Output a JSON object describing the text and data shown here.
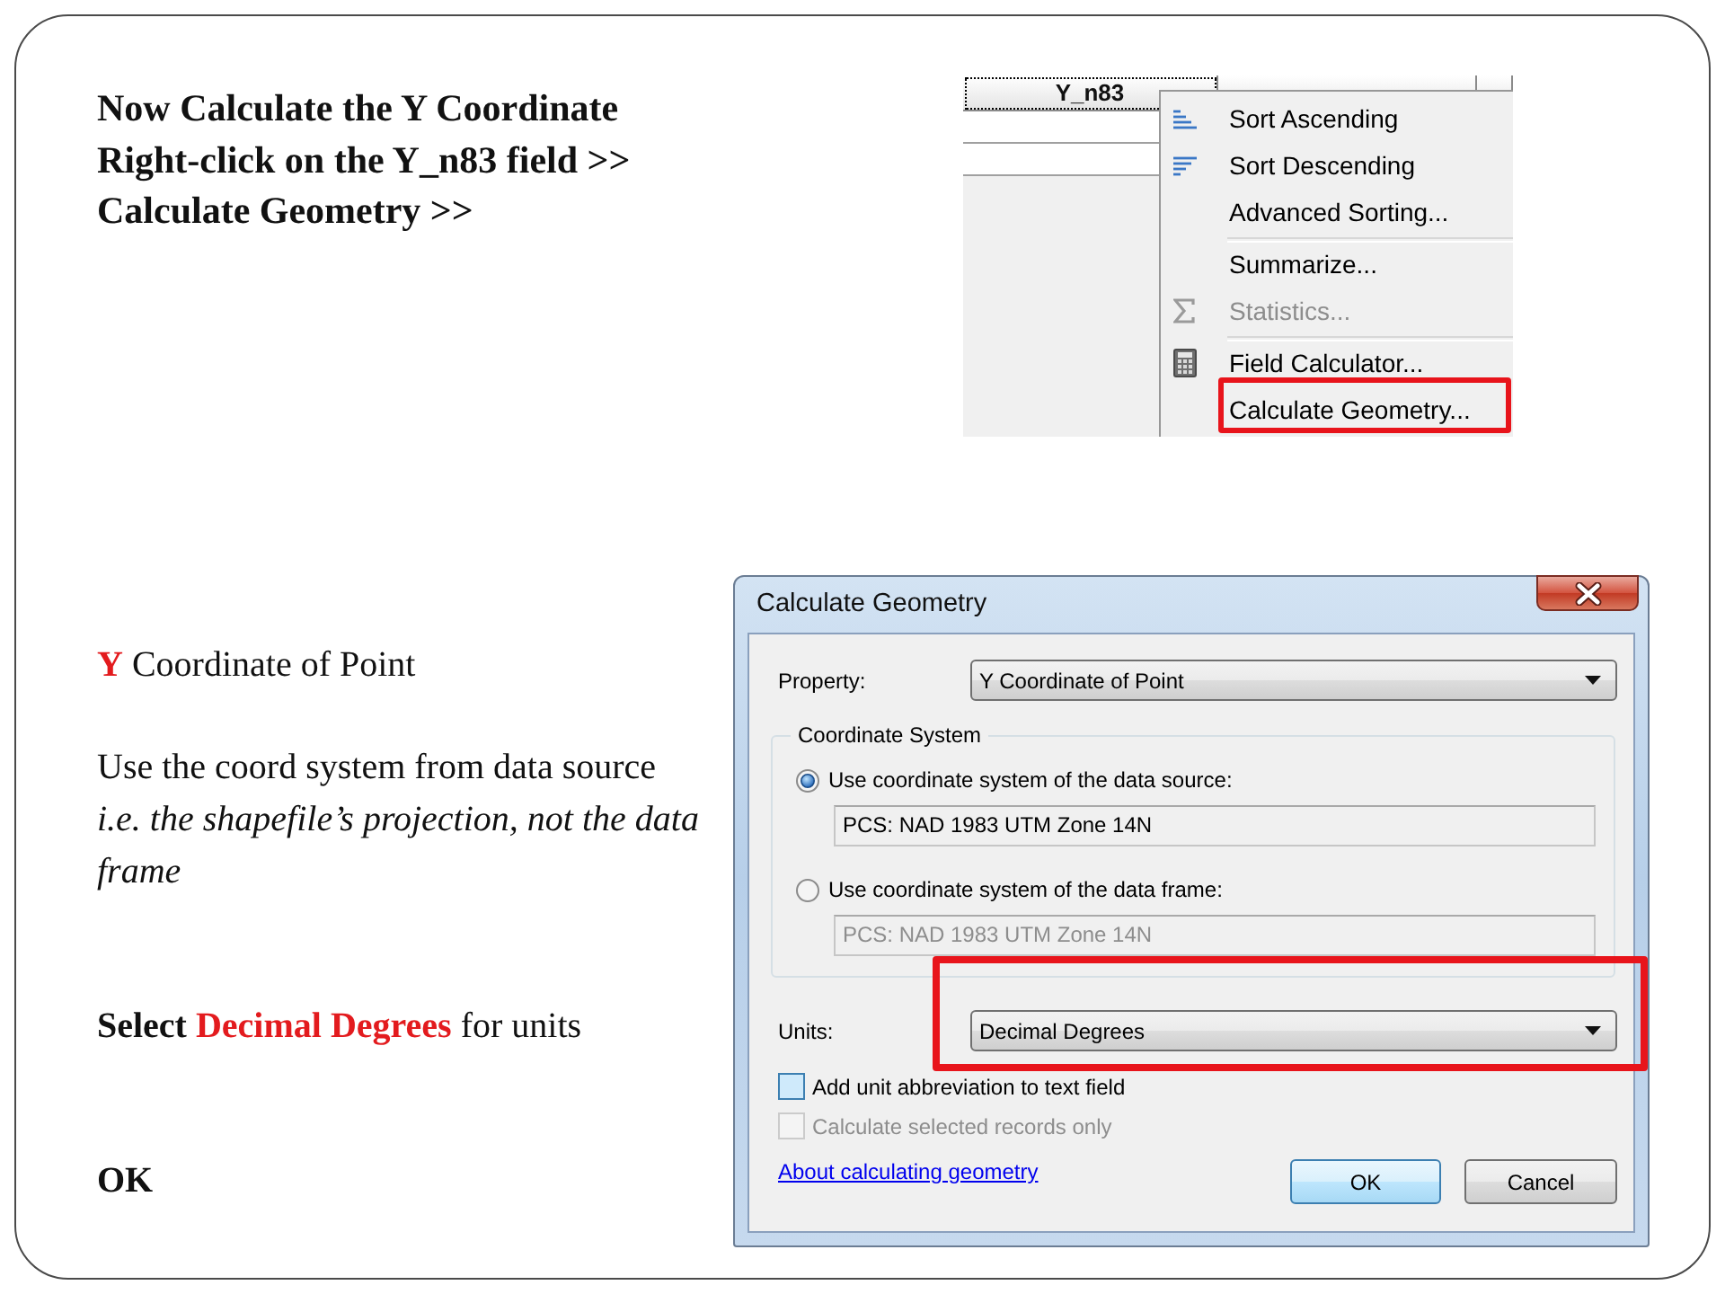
{
  "instructions": [
    "Now Calculate the Y Coordinate",
    "Right-click on the Y_n83 field >>",
    "Calculate Geometry >>"
  ],
  "attribute_table": {
    "columns": [
      {
        "header": "Y_n83",
        "selected": true
      }
    ],
    "context_menu": [
      {
        "kind": "ascending",
        "label": "Sort Ascending",
        "disabled": false,
        "callout": false
      },
      {
        "kind": "descending",
        "label": "Sort Descending",
        "disabled": false,
        "callout": false
      },
      {
        "kind": "text",
        "label": "Advanced Sorting...",
        "disabled": false,
        "callout": false
      },
      {
        "kind": "divider"
      },
      {
        "kind": "text",
        "label": "Summarize...",
        "disabled": false,
        "callout": false
      },
      {
        "kind": "sigma",
        "label": "Statistics...",
        "disabled": true,
        "callout": false
      },
      {
        "kind": "divider"
      },
      {
        "kind": "calculator",
        "label": "Field Calculator...",
        "disabled": false,
        "callout": false
      },
      {
        "kind": "text",
        "label": "Calculate Geometry...",
        "disabled": false,
        "callout": true
      }
    ]
  },
  "notes": [
    {
      "paragraphs": [
        {
          "segments": [
            {
              "kind": "highlight",
              "text": "Y"
            },
            {
              "kind": "plain",
              "text": "Coordinate of Point"
            }
          ]
        }
      ]
    },
    {
      "paragraphs": [
        {
          "segments": [
            {
              "kind": "plain",
              "text": "Use the coord system from data source"
            }
          ]
        },
        {
          "segments": [
            {
              "kind": "italic",
              "text": "i.e. the shapefile’s projection, not the data frame"
            }
          ]
        }
      ]
    },
    {
      "paragraphs": [
        {
          "segments": [
            {
              "kind": "bold",
              "text": "Select"
            },
            {
              "kind": "highlight",
              "text": "Decimal Degrees"
            },
            {
              "kind": "plain",
              "text": "for units"
            }
          ]
        }
      ]
    },
    {
      "paragraphs": [
        {
          "segments": [
            {
              "kind": "bold",
              "text": "OK"
            }
          ]
        }
      ]
    }
  ],
  "dialog": {
    "title": "Calculate Geometry",
    "property": {
      "label": "Property:",
      "value": "Y Coordinate of Point"
    },
    "coordinate_system": {
      "legend": "Coordinate System",
      "options": [
        {
          "label": "Use coordinate system of the data source:",
          "selected": true,
          "value": "PCS: NAD 1983 UTM Zone 14N"
        },
        {
          "label": "Use coordinate system of the data frame:",
          "selected": false,
          "value": "PCS: NAD 1983 UTM Zone 14N"
        }
      ]
    },
    "units": {
      "label": "Units:",
      "value": "Decimal Degrees",
      "callout": true
    },
    "checkboxes": [
      {
        "label": "Add unit abbreviation to text field",
        "checked": false,
        "disabled": false,
        "hovered": true
      },
      {
        "label": "Calculate selected records only",
        "checked": false,
        "disabled": true,
        "hovered": false
      }
    ],
    "help_link": "About calculating geometry",
    "buttons": [
      {
        "label": "OK",
        "default": true
      },
      {
        "label": "Cancel",
        "default": false
      }
    ]
  }
}
